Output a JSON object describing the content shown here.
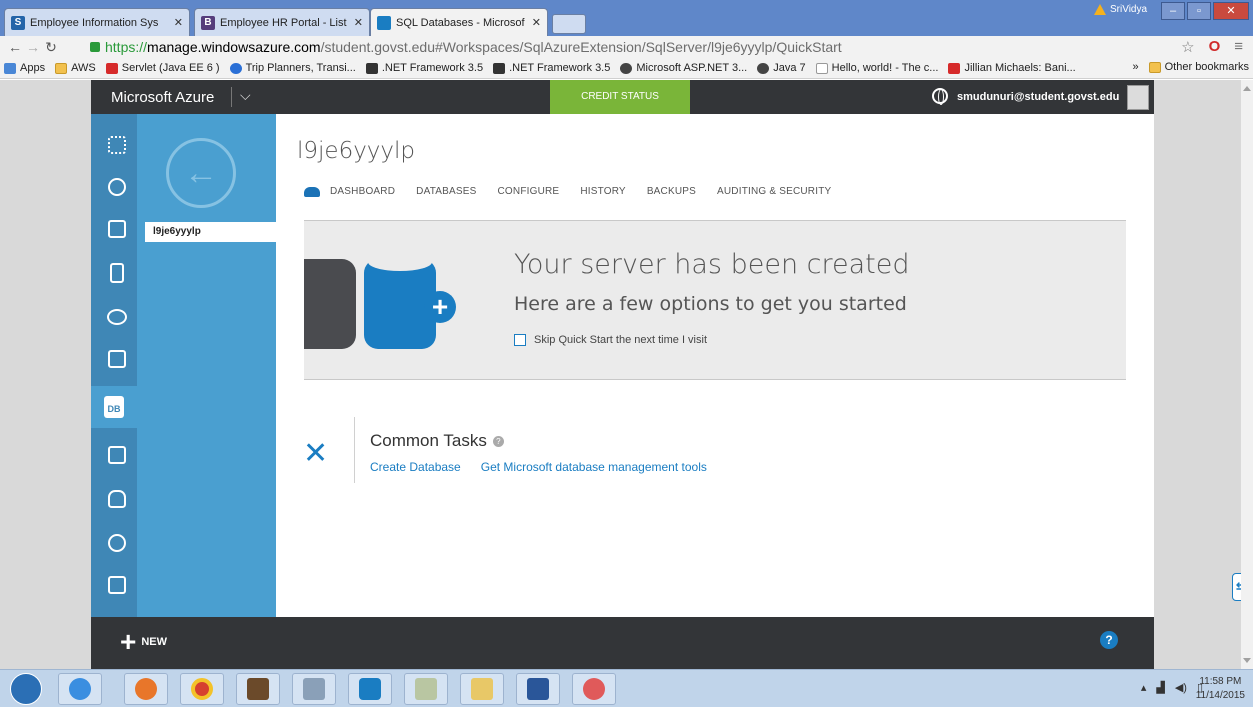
{
  "browser": {
    "tabs": [
      {
        "title": "Employee Information Sys",
        "favicon": "S",
        "favicon_color": "#2464a8",
        "active": false
      },
      {
        "title": "Employee HR Portal - List",
        "favicon": "B",
        "favicon_color": "#563d7c",
        "active": false
      },
      {
        "title": "SQL Databases - Microsof",
        "favicon": "win",
        "favicon_color": "#1a7dc2",
        "active": true
      }
    ],
    "profile_name": "SriVidya",
    "url": {
      "scheme": "https://",
      "host": "manage.windowsazure.com",
      "path": "/student.govst.edu#Workspaces/SqlAzureExtension/SqlServer/l9je6yyylp/QuickStart"
    },
    "bookmarks": [
      {
        "label": "Apps",
        "icon": "apps-icon"
      },
      {
        "label": "AWS",
        "icon": "folder-icon"
      },
      {
        "label": "Servlet (Java EE 6 )",
        "icon": "youtube-icon"
      },
      {
        "label": "Trip Planners, Transi...",
        "icon": "transit-icon"
      },
      {
        "label": ".NET Framework 3.5",
        "icon": "m-icon"
      },
      {
        "label": ".NET Framework 3.5",
        "icon": "m-icon"
      },
      {
        "label": "Microsoft ASP.NET 3...",
        "icon": "globe-icon"
      },
      {
        "label": "Java 7",
        "icon": "globe-icon"
      },
      {
        "label": "Hello, world! - The c...",
        "icon": "page-icon"
      },
      {
        "label": "Jillian Michaels: Bani...",
        "icon": "youtube-icon"
      }
    ],
    "bookmarks_overflow": "»",
    "other_bookmarks": "Other bookmarks"
  },
  "azure": {
    "brand": "Microsoft Azure",
    "credit_status": "CREDIT STATUS",
    "user": "smudunuri@student.govst.edu",
    "nav_item": "l9je6yyylp",
    "server_name": "l9je6yyylp",
    "tabs": [
      "DASHBOARD",
      "DATABASES",
      "CONFIGURE",
      "HISTORY",
      "BACKUPS",
      "AUDITING & SECURITY"
    ],
    "hero_title": "Your server has been created",
    "hero_subtitle": "Here are a few options to get you started",
    "skip_label": "Skip Quick Start the next time I visit",
    "common_tasks_title": "Common Tasks",
    "task_links": [
      "Create Database",
      "Get Microsoft database management tools"
    ],
    "new_label": "NEW",
    "help_label": "?",
    "db_icon_label": "DB"
  },
  "taskbar": {
    "time": "11:58 PM",
    "date": "11/14/2015"
  }
}
